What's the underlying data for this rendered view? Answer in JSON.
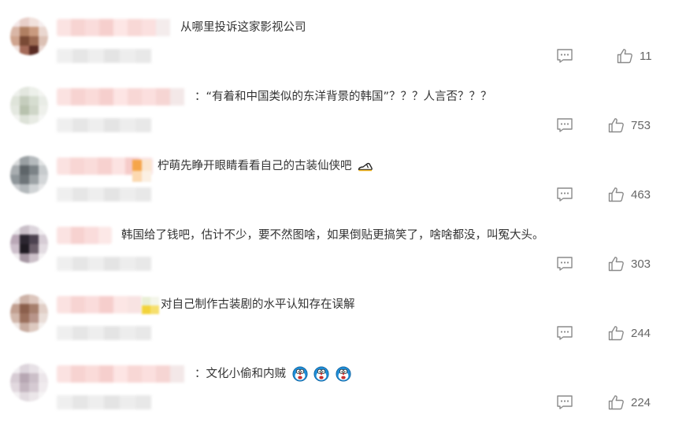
{
  "comments": [
    {
      "text": "从哪里投诉这家影视公司",
      "likes": "11"
    },
    {
      "text": "：“有着和中国类似的东洋背景的韩国”？？？人言否？？？",
      "likes": "753"
    },
    {
      "text": "柠萌先睁开眼睛看看自己的古装仙侠吧",
      "likes": "463"
    },
    {
      "text": "韩国给了钱吧，估计不少，要不然图啥，如果倒贴更搞笑了，啥啥都没，叫冤大头。",
      "likes": "303"
    },
    {
      "text": "对自己制作古装剧的水平认知存在误解",
      "likes": "244"
    },
    {
      "text": "：文化小偷和内贼",
      "likes": "224"
    }
  ],
  "icons": {
    "comment": "comment-bubble-icon",
    "like": "thumbs-up-icon",
    "emoji_comment3": "slipper-emoji-icon",
    "emoji_comment6": "doraemon-emoji-icon"
  },
  "colors": {
    "text": "#333333",
    "count": "#666666",
    "icon": "#8a8a8a"
  }
}
